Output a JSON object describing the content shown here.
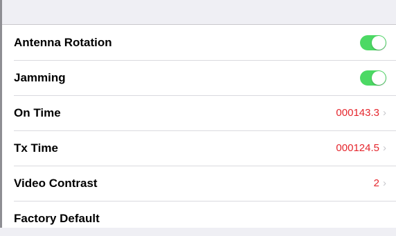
{
  "settings": {
    "rows": [
      {
        "label": "Antenna Rotation",
        "type": "toggle",
        "on": true
      },
      {
        "label": "Jamming",
        "type": "toggle",
        "on": true
      },
      {
        "label": "On Time",
        "type": "value",
        "value": "000143.3",
        "icon": "chevron-right-icon"
      },
      {
        "label": "Tx Time",
        "type": "value",
        "value": "000124.5",
        "icon": "chevron-right-icon"
      },
      {
        "label": "Video Contrast",
        "type": "value",
        "value": "2",
        "icon": "chevron-right-icon"
      },
      {
        "label": "Factory Default",
        "type": "action"
      }
    ]
  },
  "colors": {
    "toggle_on": "#4cd964",
    "value_text": "#e5252c",
    "chevron": "#c7c7cc"
  }
}
